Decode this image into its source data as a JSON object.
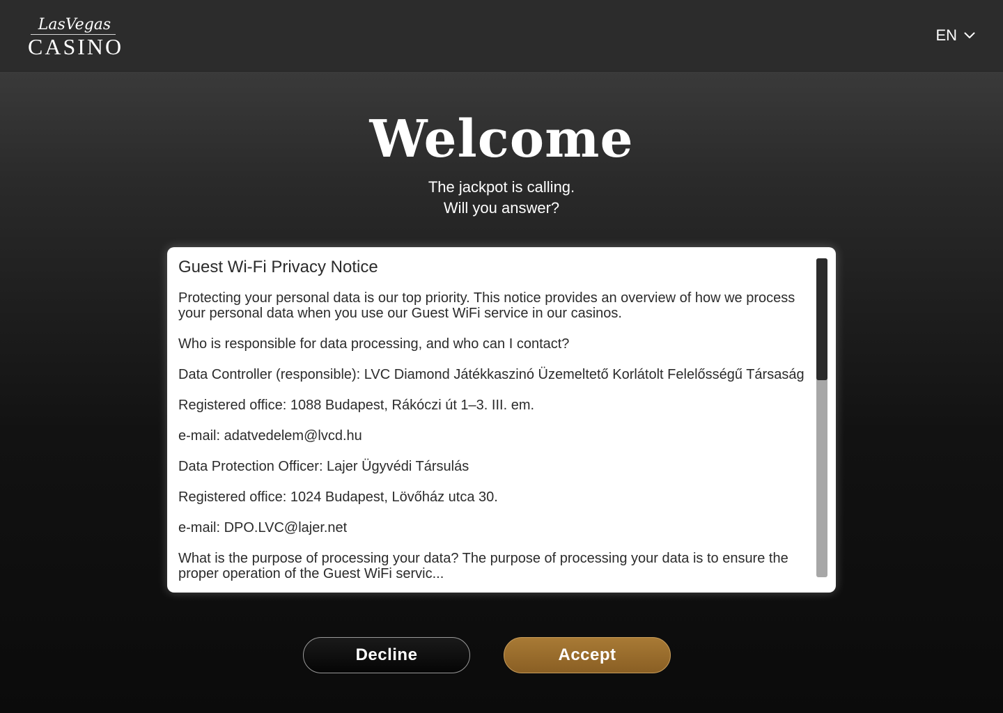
{
  "header": {
    "logo": {
      "script_text": "LasVegas",
      "main_text": "CASINO"
    },
    "language": {
      "selected": "EN",
      "icon": "chevron-down-icon"
    }
  },
  "hero": {
    "title": "Welcome",
    "subtitle_line1": "The jackpot is calling.",
    "subtitle_line2": "Will you answer?"
  },
  "notice": {
    "title": "Guest Wi-Fi Privacy Notice",
    "paragraphs": [
      "Protecting your personal data is our top priority. This notice provides an overview of how we process your personal data when you use our Guest WiFi service in our casinos.",
      "Who is responsible for data processing, and who can I contact?",
      "Data Controller (responsible): LVC Diamond Játékkaszinó Üzemeltető Korlátolt Felelősségű Társaság",
      "Registered office: 1088 Budapest, Rákóczi út 1–3. III. em.",
      "e-mail: adatvedelem@lvcd.hu",
      "Data Protection Officer: Lajer Ügyvédi Társulás",
      "Registered office: 1024 Budapest, Lövőház utca 30.",
      "e-mail: DPO.LVC@lajer.net",
      "What is the purpose of processing your data? The purpose of processing your data is to ensure the proper operation of the Guest WiFi servic..."
    ]
  },
  "actions": {
    "decline_label": "Decline",
    "accept_label": "Accept"
  },
  "colors": {
    "accent": "#9a6d2e",
    "header_bg": "#2c2c2c",
    "panel_bg": "#ffffff",
    "text_dark": "#2b2b2b"
  }
}
